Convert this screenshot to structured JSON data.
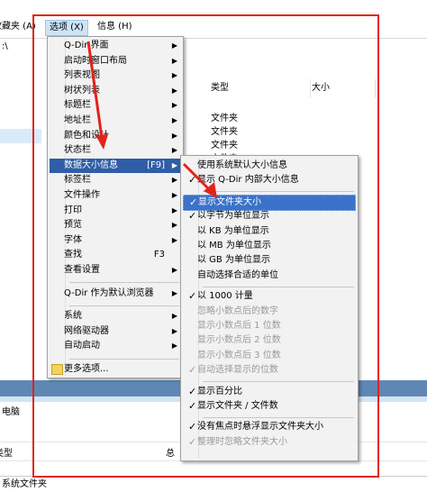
{
  "menubar": {
    "favorites": "收藏夹 (A)",
    "options": "选项 (X)",
    "info": "信息 (H)"
  },
  "path_text": ":\\",
  "columns": {
    "type": "类型",
    "size": "大小"
  },
  "file_rows": [
    "文件夹",
    "文件夹",
    "文件夹",
    "文件夹",
    "文件夹"
  ],
  "options_menu": [
    {
      "label": "Q-Dir 界面",
      "arrow": true
    },
    {
      "label": "启动时窗口布局",
      "arrow": true
    },
    {
      "label": "列表视图",
      "arrow": true
    },
    {
      "label": "树状列表",
      "arrow": true
    },
    {
      "label": "标题栏",
      "arrow": true
    },
    {
      "label": "地址栏",
      "arrow": true
    },
    {
      "label": "颜色和设计",
      "arrow": true
    },
    {
      "label": "状态栏",
      "arrow": true
    },
    {
      "label": "数据大小信息",
      "accel": "[F9]",
      "arrow": true,
      "highlight": true
    },
    {
      "label": "标签栏",
      "arrow": true
    },
    {
      "label": "文件操作",
      "arrow": true
    },
    {
      "label": "打印",
      "arrow": true
    },
    {
      "label": "预览",
      "arrow": true
    },
    {
      "label": "字体",
      "arrow": true
    },
    {
      "label": "查找",
      "accel": "F3"
    },
    {
      "label": "查看设置",
      "arrow": true
    },
    {
      "sep": true
    },
    {
      "label": "Q-Dir 作为默认浏览器",
      "arrow": true
    },
    {
      "sep": true
    },
    {
      "label": "系统",
      "arrow": true
    },
    {
      "label": "网络驱动器",
      "arrow": true
    },
    {
      "label": "自动启动",
      "arrow": true
    },
    {
      "sep": true
    },
    {
      "label": "更多选项...",
      "icon": "folder-icon"
    }
  ],
  "size_submenu": [
    {
      "label": "使用系统默认大小信息"
    },
    {
      "label": "显示 Q-Dir 内部大小信息",
      "check": true
    },
    {
      "sep": true
    },
    {
      "label": "显示文件夹大小",
      "check": true,
      "highlight": true
    },
    {
      "label": "以字节为单位显示",
      "check": true
    },
    {
      "label": "以 KB 为单位显示"
    },
    {
      "label": "以 MB 为单位显示"
    },
    {
      "label": "以 GB 为单位显示"
    },
    {
      "label": "自动选择合适的单位"
    },
    {
      "sep": true
    },
    {
      "label": "以 1000 计量",
      "check": true
    },
    {
      "label": "忽略小数点后的数字",
      "disabled": true
    },
    {
      "label": "显示小数点后 1 位数",
      "disabled": true
    },
    {
      "label": "显示小数点后 2 位数",
      "disabled": true
    },
    {
      "label": "显示小数点后 3 位数",
      "disabled": true
    },
    {
      "label": "自动选择显示的位数",
      "check": true,
      "disabled": true
    },
    {
      "sep": true
    },
    {
      "label": "显示百分比",
      "check": true
    },
    {
      "label": "显示文件夹 / 文件数",
      "check": true
    },
    {
      "sep": true
    },
    {
      "label": "没有焦点时悬浮显示文件夹大小",
      "check": true
    },
    {
      "label": "整理时忽略文件夹大小",
      "check": true,
      "disabled": true
    }
  ],
  "lower_pane": {
    "computer": "电脑",
    "type_col": "类型",
    "total_col": "总"
  },
  "status_text": "系统文件夹",
  "colors": {
    "highlight": "#2f5ea6",
    "annotation_red": "#e2231a",
    "divider": "#5f87b4"
  }
}
